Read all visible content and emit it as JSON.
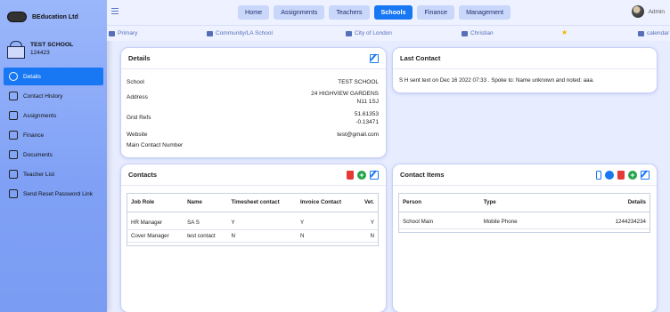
{
  "brand": {
    "name": "BEducation Ltd"
  },
  "school": {
    "name": "TEST SCHOOL",
    "id": "124423"
  },
  "sidebar": {
    "items": [
      {
        "label": "Details",
        "icon": "details-icon",
        "active": true
      },
      {
        "label": "Contact History",
        "icon": "history-icon"
      },
      {
        "label": "Assignments",
        "icon": "assignments-icon"
      },
      {
        "label": "Finance",
        "icon": "finance-icon"
      },
      {
        "label": "Documents",
        "icon": "documents-icon"
      },
      {
        "label": "Teacher List",
        "icon": "teacher-list-icon"
      },
      {
        "label": "Send Reset Password Link",
        "icon": "key-icon"
      }
    ]
  },
  "nav": {
    "tabs": [
      "Home",
      "Assignments",
      "Teachers",
      "Schools",
      "Finance",
      "Management"
    ],
    "active": "Schools"
  },
  "user": {
    "name": "Admin"
  },
  "info": {
    "phase": "Primary",
    "type": "Community/LA School",
    "city": "City of London",
    "religion": "Christian",
    "calendar": "calendar"
  },
  "details": {
    "title": "Details",
    "rows": [
      {
        "label": "School",
        "value": "TEST SCHOOL"
      },
      {
        "label": "Address",
        "value": "24 HIGHVIEW GARDENS",
        "value2": "N11 1SJ"
      },
      {
        "label": "Grid Refs",
        "value": "51.61353",
        "value2": "-0.13471"
      },
      {
        "label": "Website",
        "value": "test@gmail.com"
      },
      {
        "label": "Main Contact Number",
        "value": ""
      }
    ]
  },
  "last_contact": {
    "title": "Last Contact",
    "text": "S H sent text on Dec 16 2022 07:33 . Spoke to: Name unknown and noted: aaa."
  },
  "contacts": {
    "title": "Contacts",
    "headers": [
      "Job Role",
      "Name",
      "Timesheet contact",
      "Invoice Contact",
      "Vet."
    ],
    "rows": [
      [
        "HR Manager",
        "SA S",
        "Y",
        "Y",
        "Y"
      ],
      [
        "Cover Manager",
        "test contact",
        "N",
        "N",
        "N"
      ]
    ]
  },
  "contact_items": {
    "title": "Contact Items",
    "headers": [
      "Person",
      "Type",
      "Details"
    ],
    "rows": [
      [
        "School Main",
        "Mobile Phone",
        "1244234234"
      ]
    ]
  },
  "colors": {
    "accent": "#1877f2",
    "sidebar": "#8aa8f8",
    "delete": "#e53935",
    "add": "#22a34a"
  }
}
